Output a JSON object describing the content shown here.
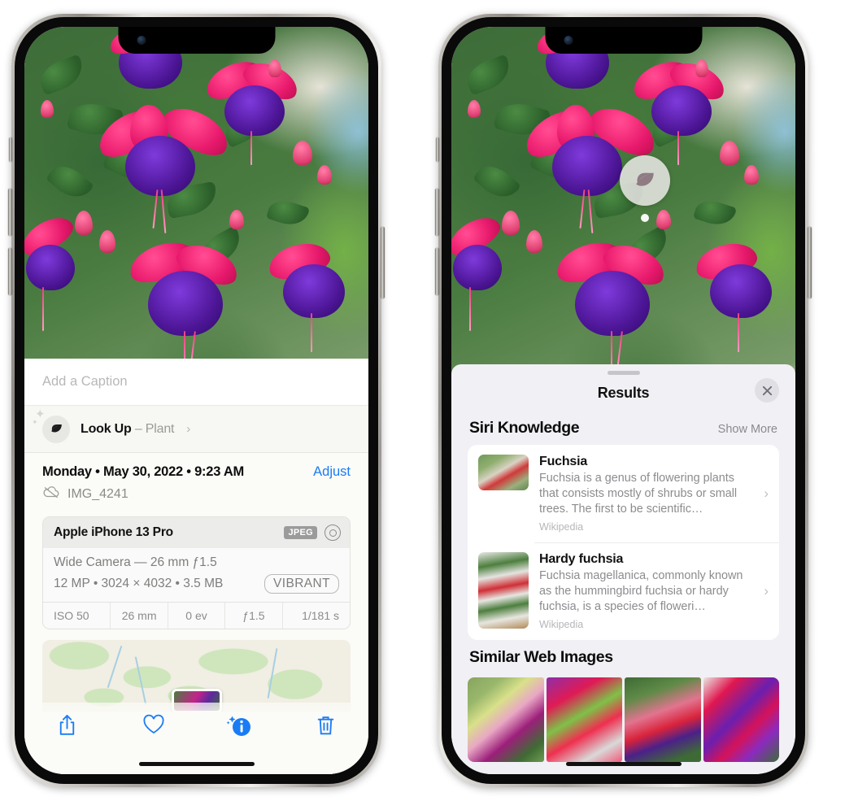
{
  "left_phone": {
    "caption_placeholder": "Add a Caption",
    "lookup": {
      "label": "Look Up",
      "dash": " – ",
      "subject": "Plant",
      "chevron": "›",
      "icon": "leaf-icon"
    },
    "info": {
      "date": "Monday • May 30, 2022 • 9:23 AM",
      "adjust_label": "Adjust",
      "filename": "IMG_4241",
      "cloud_icon": "icloud-slash-icon"
    },
    "camera_card": {
      "device": "Apple iPhone 13 Pro",
      "format_tag": "JPEG",
      "raw_icon": "aperture-icon",
      "lens_line": "Wide Camera — 26 mm ƒ1.5",
      "specs_line": "12 MP • 3024 × 4032 • 3.5 MB",
      "style_tag": "VIBRANT",
      "exif": [
        "ISO 50",
        "26 mm",
        "0 ev",
        "ƒ1.5",
        "1/181 s"
      ]
    },
    "toolbar": [
      {
        "name": "share-button",
        "icon": "share-icon"
      },
      {
        "name": "favorite-button",
        "icon": "heart-icon"
      },
      {
        "name": "info-button",
        "icon": "info-sparkle-icon"
      },
      {
        "name": "delete-button",
        "icon": "trash-icon"
      }
    ],
    "accent_color": "#1a7cf5"
  },
  "right_phone": {
    "visual_lookup_badge": {
      "icon": "leaf-icon",
      "name": "visual-lookup-badge"
    },
    "results_panel": {
      "title": "Results",
      "close_icon": "close-icon",
      "sections": [
        {
          "title": "Siri Knowledge",
          "action_label": "Show More",
          "items": [
            {
              "title": "Fuchsia",
              "description": "Fuchsia is a genus of flowering plants that consists mostly of shrubs or small trees. The first to be scientific…",
              "source": "Wikipedia"
            },
            {
              "title": "Hardy fuchsia",
              "description": "Fuchsia magellanica, commonly known as the hummingbird fuchsia or hardy fuchsia, is a species of floweri…",
              "source": "Wikipedia"
            }
          ]
        },
        {
          "title": "Similar Web Images",
          "thumbnails": [
            "web-image-1",
            "web-image-2",
            "web-image-3",
            "web-image-4"
          ]
        }
      ]
    }
  }
}
